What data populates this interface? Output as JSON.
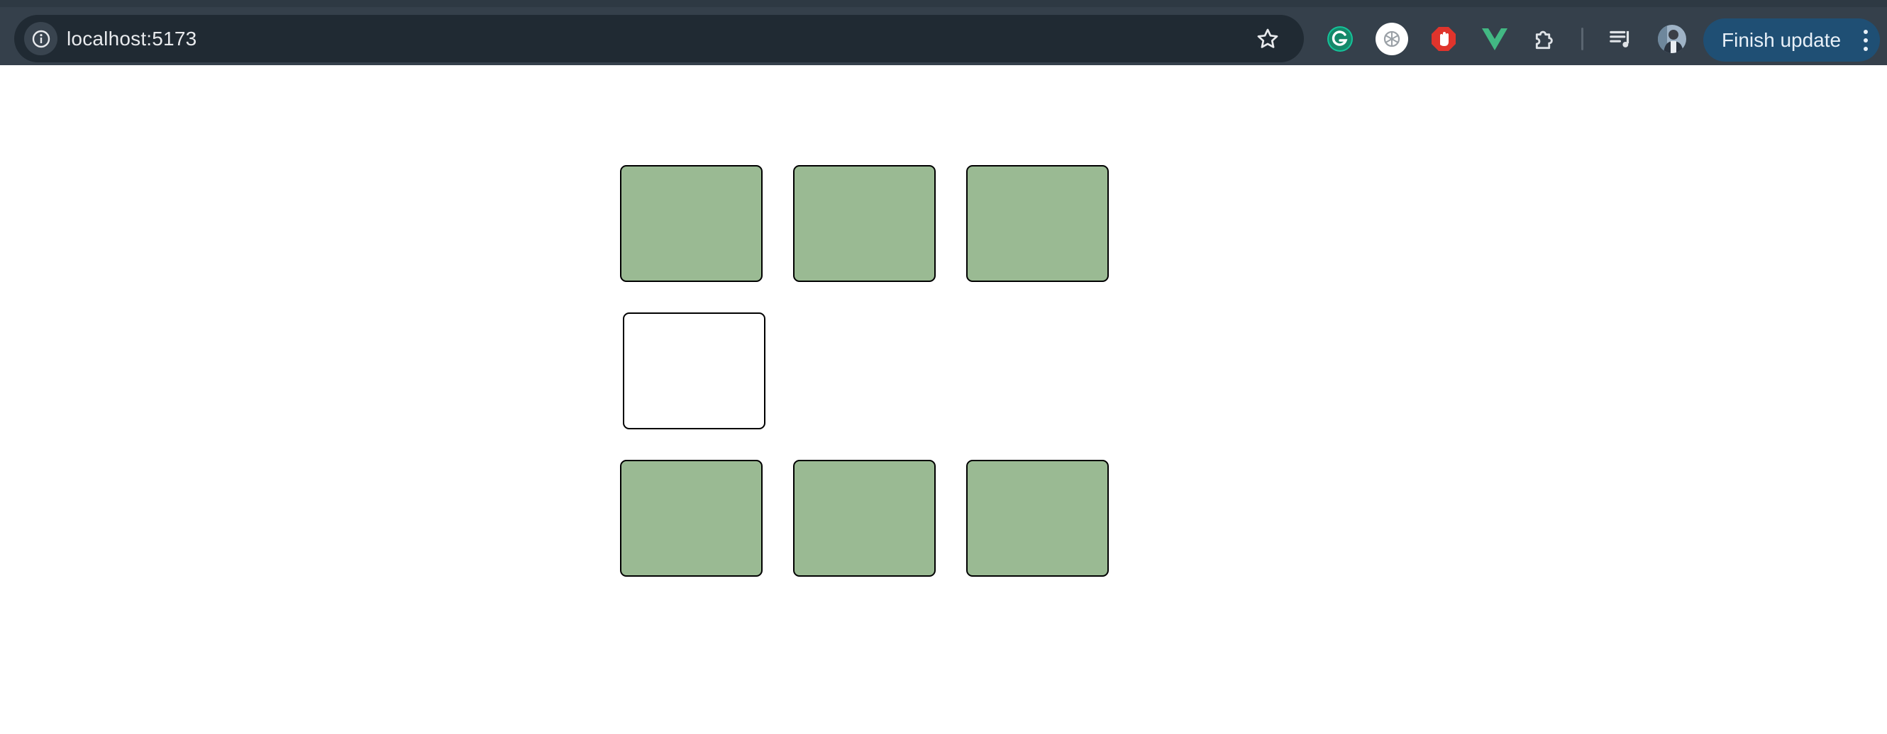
{
  "browser": {
    "url": "localhost:5173",
    "finish_update_label": "Finish update",
    "icons": {
      "site_info": "info-icon",
      "bookmark": "star-icon",
      "extensions": [
        "grammarly-icon",
        "chatgpt-icon",
        "adblock-hand-icon",
        "vue-devtools-icon",
        "puzzle-extensions-icon"
      ],
      "reading_list": "reading-list-icon",
      "profile": "avatar",
      "menu": "kebab-menu-icon"
    },
    "colors": {
      "toolbar": "#35404b",
      "omnibox": "#202a33",
      "finish_update_bg": "#1f4f74"
    }
  },
  "page": {
    "tiles": [
      {
        "row": 1,
        "col": 1,
        "state": "filled",
        "color": "#9aba93"
      },
      {
        "row": 1,
        "col": 2,
        "state": "filled",
        "color": "#9aba93"
      },
      {
        "row": 1,
        "col": 3,
        "state": "filled",
        "color": "#9aba93"
      },
      {
        "row": 2,
        "col": 1,
        "state": "empty",
        "color": "#ffffff"
      },
      {
        "row": 3,
        "col": 1,
        "state": "filled",
        "color": "#9aba93"
      },
      {
        "row": 3,
        "col": 2,
        "state": "filled",
        "color": "#9aba93"
      },
      {
        "row": 3,
        "col": 3,
        "state": "filled",
        "color": "#9aba93"
      }
    ]
  }
}
